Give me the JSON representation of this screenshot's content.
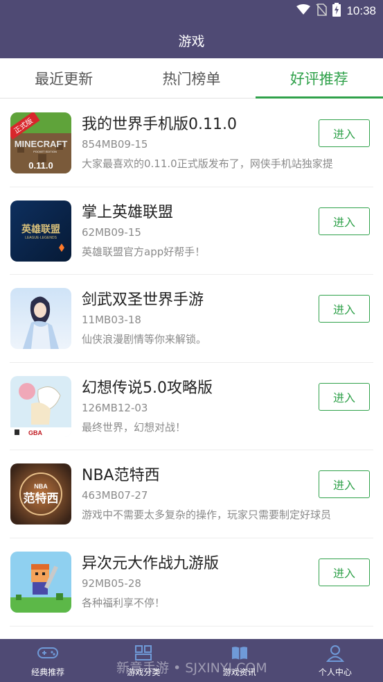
{
  "status_bar": {
    "time": "10:38"
  },
  "header": {
    "title": "游戏"
  },
  "tabs": [
    {
      "label": "最近更新",
      "active": false
    },
    {
      "label": "热门榜单",
      "active": false
    },
    {
      "label": "好评推荐",
      "active": true
    }
  ],
  "games": [
    {
      "name": "我的世界手机版0.11.0",
      "meta": "854MB09-15",
      "desc": "大家最喜欢的0.11.0正式版发布了，网侠手机站独家提",
      "thumb_badge": "正式版",
      "thumb_title": "MINECRAFT",
      "thumb_sub": "POCKET EDITION",
      "thumb_version": "0.11.0",
      "button": "进入"
    },
    {
      "name": "掌上英雄联盟",
      "meta": "62MB09-15",
      "desc": "英雄联盟官方app好帮手！",
      "thumb_title": "英雄联盟",
      "thumb_sub": "LEAGUE·LEGENDS",
      "button": "进入"
    },
    {
      "name": "剑武双圣世界手游",
      "meta": "11MB03-18",
      "desc": "仙侠浪漫剧情等你来解锁。",
      "button": "进入"
    },
    {
      "name": "幻想传说5.0攻略版",
      "meta": "126MB12-03",
      "desc": "最终世界，幻想对战！",
      "thumb_title": "GBA",
      "button": "进入"
    },
    {
      "name": "NBA范特西",
      "meta": "463MB07-27",
      "desc": "游戏中不需要太多复杂的操作，玩家只需要制定好球员",
      "thumb_title": "NBA",
      "thumb_sub": "范特西",
      "button": "进入"
    },
    {
      "name": "异次元大作战九游版",
      "meta": "92MB05-28",
      "desc": "各种福利享不停！",
      "button": "进入"
    }
  ],
  "bottom_nav": [
    {
      "label": "经典推荐",
      "icon": "controller-icon"
    },
    {
      "label": "游戏分类",
      "icon": "grid-icon"
    },
    {
      "label": "游戏资讯",
      "icon": "book-icon"
    },
    {
      "label": "个人中心",
      "icon": "user-icon"
    }
  ],
  "watermark": "新意手游 • SJXINYI.COM",
  "colors": {
    "header_bg": "#4f4a74",
    "accent": "#2fa14a",
    "text": "#222222",
    "muted": "#8a8a8a"
  }
}
